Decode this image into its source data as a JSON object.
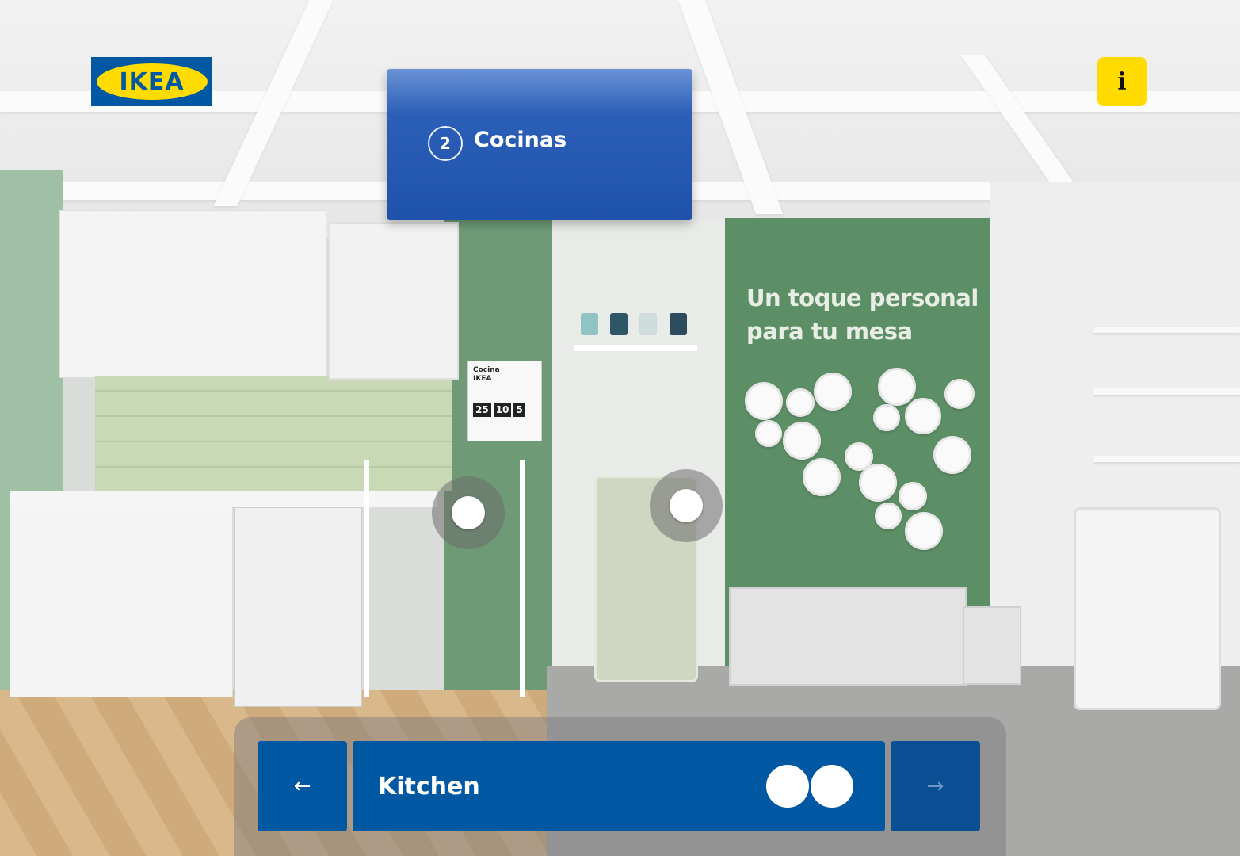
{
  "brand": {
    "logo_text": "IKEA",
    "colors": {
      "blue": "#0058a3",
      "yellow": "#ffdb00"
    }
  },
  "info_button": {
    "icon": "info-icon",
    "label": "i"
  },
  "section_sign": {
    "number": "2",
    "title": "Cocinas"
  },
  "wall_text": {
    "line1": "Un toque personal",
    "line2": "para tu mesa"
  },
  "price_card": {
    "title_line1": "Cocina",
    "title_line2": "IKEA",
    "values": [
      "25",
      "10",
      "5"
    ]
  },
  "hotspots": [
    {
      "name": "hotspot-kitchen-stool"
    },
    {
      "name": "hotspot-trolley"
    }
  ],
  "navigation": {
    "prev_icon": "arrow-left-icon",
    "prev_label": "←",
    "current_room": "Kitchen",
    "next_icon": "arrow-right-icon",
    "next_label": "→",
    "toggle_icon": "two-dots-icon"
  }
}
